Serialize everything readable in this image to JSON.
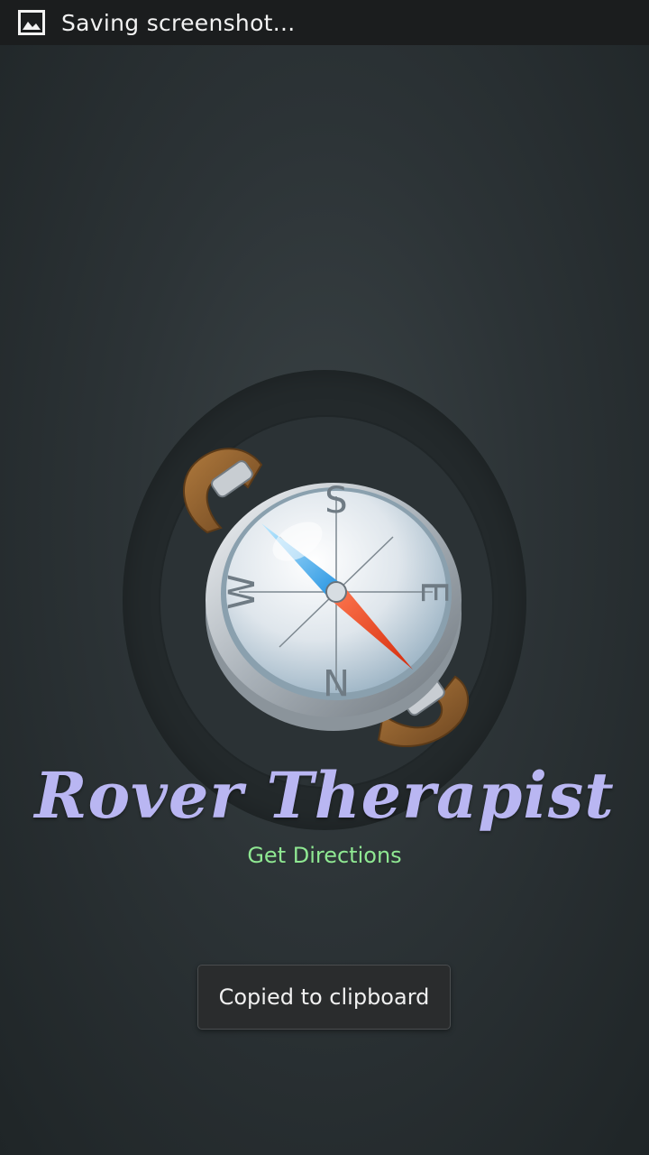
{
  "status_bar": {
    "icon": "image-icon",
    "text": "Saving screenshot..."
  },
  "splash": {
    "logo_icon": "compass-icon",
    "compass_letters": {
      "north": "N",
      "south": "S",
      "east": "E",
      "west": "W"
    },
    "title": "Rover Therapist",
    "subtitle": "Get Directions"
  },
  "toast": {
    "message": "Copied to clipboard"
  },
  "colors": {
    "title": "#b9b6f2",
    "subtitle": "#8fe892",
    "background": "#2c3336",
    "status_bar": "#1b1d1e"
  }
}
